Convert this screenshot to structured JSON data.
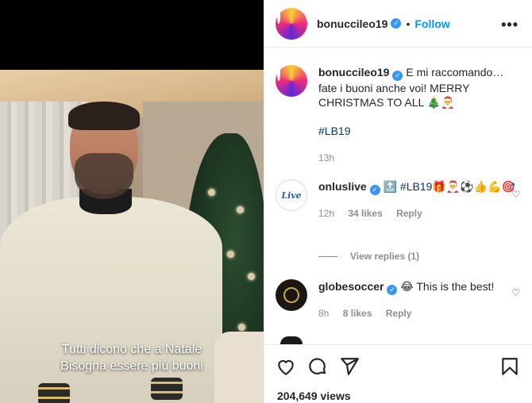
{
  "video": {
    "subtitle_line1": "Tutti dicono che a Natale",
    "subtitle_line2": "Bisogna essere più buoni"
  },
  "header": {
    "username": "bonuccileo19",
    "separator": "•",
    "follow_label": "Follow",
    "more_icon": "more-horizontal-icon"
  },
  "caption": {
    "username": "bonuccileo19",
    "text": "E mi raccomando… fate i buoni anche voi! MERRY CHRISTMAS TO ALL 🎄🎅",
    "hashtag": "#LB19",
    "time": "13h"
  },
  "comments": [
    {
      "username": "onluslive",
      "text_prefix": "🔝",
      "hashtag": "#LB19",
      "text_suffix": "🎁🎅⚽👍💪🎯",
      "time": "12h",
      "likes": "34 likes",
      "reply_label": "Reply",
      "avatar_text": "Live"
    },
    {
      "username": "globesoccer",
      "text": "😂 This is the best!",
      "time": "8h",
      "likes": "8 likes",
      "reply_label": "Reply"
    }
  ],
  "view_replies": "View replies (1)",
  "actions": {
    "like_icon": "heart-icon",
    "comment_icon": "comment-icon",
    "share_icon": "share-icon",
    "save_icon": "bookmark-icon"
  },
  "views": "204,649 views",
  "colors": {
    "link_blue": "#0095f6",
    "hashtag_blue": "#00376b",
    "muted": "#8e8e8e",
    "verified": "#3897f0"
  }
}
